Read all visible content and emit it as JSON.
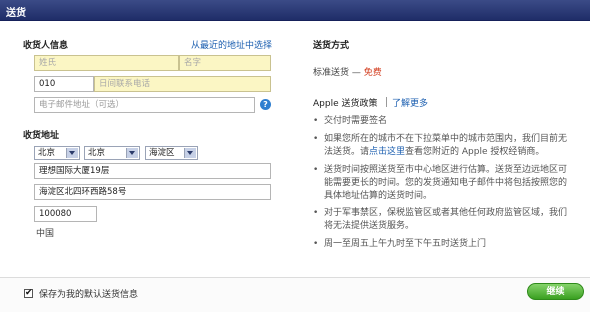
{
  "header": {
    "title": "送货"
  },
  "recipient": {
    "title": "收货人信息",
    "recent_link": "从最近的地址中选择",
    "last_name_placeholder": "姓氏",
    "first_name_placeholder": "名字",
    "area_code": "010",
    "phone_placeholder": "日间联系电话",
    "email_placeholder": "电子邮件地址（可选）",
    "help_icon": "question-mark-icon"
  },
  "address": {
    "title": "收货地址",
    "province": "北京",
    "city": "北京",
    "district": "海淀区",
    "line1": "理想国际大厦19层",
    "line2": "海淀区北四环西路58号",
    "postcode": "100080",
    "country": "中国"
  },
  "shipping": {
    "title": "送货方式",
    "method_label": "标准送货 —",
    "method_price": "免费",
    "policy_title": "Apple 送货政策",
    "policy_link": "了解更多",
    "bullets": [
      {
        "text": "交付时需要签名"
      },
      {
        "pre": "如果您所在的城市不在下拉菜单中的城市范围内，我们目前无法送货。请",
        "link": "点击这里",
        "post": "查看您附近的 Apple 授权经销商。"
      },
      {
        "text": "送货时间按照送货至市中心地区进行估算。送货至边远地区可能需要更长的时间。您的发货通知电子邮件中将包括按照您的具体地址估算的送货时间。"
      },
      {
        "text": "对于军事禁区，保税监管区或者其他任何政府监管区域，我们将无法提供送货服务。"
      },
      {
        "text": "周一至周五上午九时至下午五时送货上门"
      }
    ]
  },
  "footer": {
    "save_default_label": "保存为我的默认送货信息",
    "save_default_checked": "✔",
    "continue_label": "继续"
  },
  "colors": {
    "header_bg": "#2a3a78",
    "link": "#1c5fb0",
    "free": "#d23a1b",
    "field_highlight": "#fbf6c4",
    "continue_button": "#4cb332"
  }
}
